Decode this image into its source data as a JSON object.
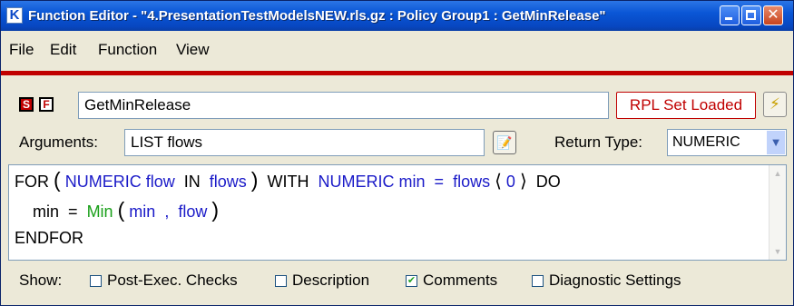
{
  "window": {
    "app_icon_letter": "K",
    "title": "Function Editor - \"4.PresentationTestModelsNEW.rls.gz : Policy Group1 : GetMinRelease\""
  },
  "menu": [
    "File",
    "Edit",
    "Function",
    "View"
  ],
  "toolbar": {
    "s_icon_letter": "S",
    "f_icon_letter": "F",
    "function_name": "GetMinRelease",
    "rpl_button": "RPL Set Loaded",
    "bolt_icon": "lightning-icon"
  },
  "arguments": {
    "label": "Arguments:",
    "value": "LIST flows",
    "return_type_label": "Return Type:",
    "return_type_value": "NUMERIC"
  },
  "code": {
    "line1": {
      "t1": "FOR",
      "p_open": "(",
      "t2": "NUMERIC flow",
      "t3": " IN ",
      "t4": "flows",
      "p_close": ")",
      "t5": " WITH ",
      "t6": "NUMERIC min",
      "t7": " = ",
      "t8": "flows",
      "a_open": "⟨",
      "t9": "0",
      "a_close": "⟩",
      "t10": " DO"
    },
    "line2": {
      "t1": "min",
      "t2": " = ",
      "t3": "Min",
      "p_open": "(",
      "t4": "min",
      "t5": " , ",
      "t6": "flow",
      "p_close": ")"
    },
    "line3": "ENDFOR"
  },
  "show": {
    "label": "Show:",
    "options": [
      {
        "label": "Post-Exec. Checks",
        "checked": false
      },
      {
        "label": "Description",
        "checked": false
      },
      {
        "label": "Comments",
        "checked": true
      },
      {
        "label": "Diagnostic Settings",
        "checked": false
      }
    ]
  },
  "colors": {
    "keyword_blue": "#1a1ac8",
    "function_green": "#1aa01a",
    "accent_red": "#c00000"
  }
}
